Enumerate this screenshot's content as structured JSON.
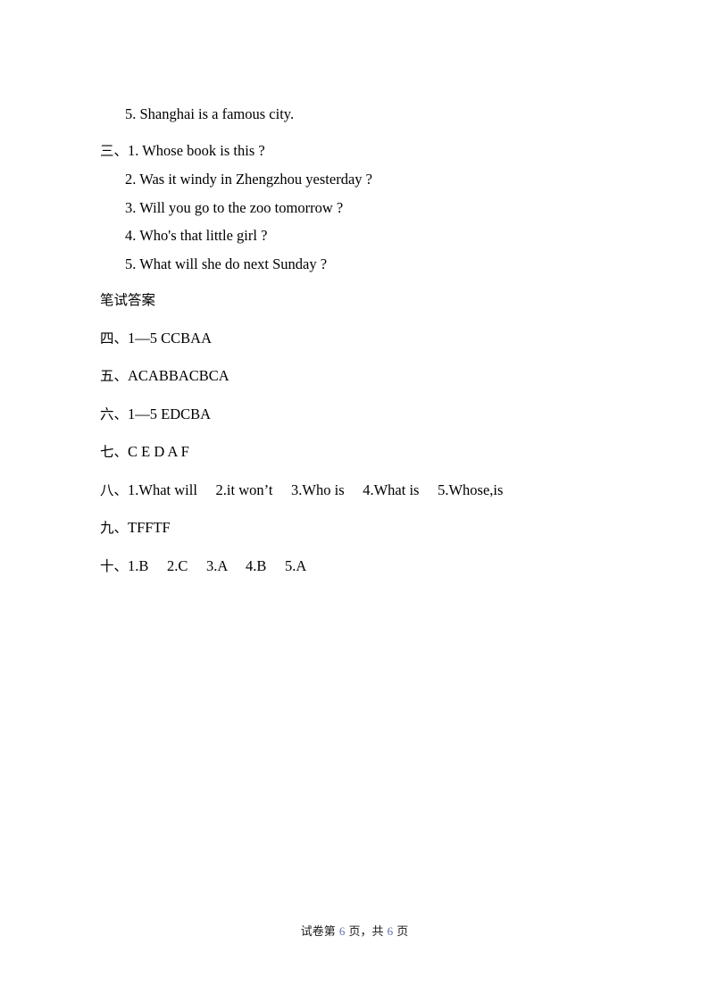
{
  "document": {
    "listening_section": {
      "trailing_item": "5. Shanghai is a famous city.",
      "ordinal": "三、",
      "items": [
        "1. Whose book is this ?",
        "2. Was it windy in Zhengzhou yesterday ?",
        "3. Will you go to the zoo tomorrow ?",
        "4. Who's that little girl ?",
        "5. What will she do next Sunday ?"
      ]
    },
    "written_answers": {
      "heading": "笔试答案",
      "entries": [
        {
          "ordinal": "四、",
          "answer": "1—5 CCBAA"
        },
        {
          "ordinal": "五、",
          "answer": "ACABBACBCA"
        },
        {
          "ordinal": "六、",
          "answer": "1—5 EDCBA"
        },
        {
          "ordinal": "七、",
          "answer": "C E D A F"
        },
        {
          "ordinal": "八、",
          "answer": "1.What will     2.it won’t     3.Who is     4.What is     5.Whose,is"
        },
        {
          "ordinal": "九、",
          "answer": "TFFTF"
        },
        {
          "ordinal": "十、",
          "answer": "1.B     2.C     3.A     4.B     5.A"
        }
      ]
    },
    "footer": {
      "prefix": "试卷第 ",
      "current_page": "6",
      "middle": " 页，共 ",
      "total_pages": "6",
      "suffix": " 页",
      "page_number_color": "#5b6fa8"
    }
  }
}
